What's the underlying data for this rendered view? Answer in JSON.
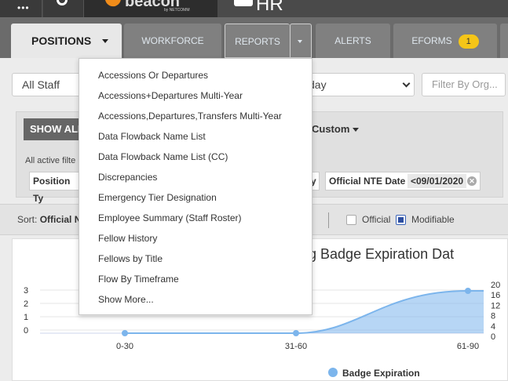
{
  "header": {
    "app_name": "HR",
    "logo_text": "beacon",
    "logo_sub": "by NETCOMM"
  },
  "tabs": [
    {
      "label": "POSITIONS"
    },
    {
      "label": "WORKFORCE"
    },
    {
      "label": "REPORTS"
    },
    {
      "label": "ALERTS"
    },
    {
      "label": "EFORMS",
      "badge": "1"
    }
  ],
  "filters": {
    "staff": "All Staff",
    "day_partial": "day",
    "org_placeholder": "Filter By Org..."
  },
  "panel": {
    "show_all": "SHOW ALL",
    "custom": "Custom",
    "active_filters": "All active filte",
    "chip_position": "Position Ty",
    "chip_y": "y",
    "chip_nte_label": "Official NTE Date",
    "chip_nte_value": "<09/01/2020"
  },
  "sortbar": {
    "sort_prefix": "Sort:",
    "sort_value": "Official N",
    "official": "Official",
    "modifiable": "Modifiable"
  },
  "reports_menu": [
    "Accessions Or Departures",
    "Accessions+Departures Multi-Year",
    "Accessions,Departures,Transfers Multi-Year",
    "Data Flowback Name List",
    "Data Flowback Name List (CC)",
    "Discrepancies",
    "Emergency Tier Designation",
    "Employee Summary (Staff Roster)",
    "Fellow History",
    "Fellows by Title",
    "Flow By Timeframe",
    "Show More..."
  ],
  "chart_title_partial": "ning Badge Expiration Dat",
  "chart_data": {
    "type": "area",
    "title": "ning Badge Expiration Dat",
    "categories": [
      "0-30",
      "31-60",
      "61-90"
    ],
    "series": [
      {
        "name": "Badge Expiration",
        "values": [
          0,
          0,
          18
        ]
      }
    ],
    "left_axis_ticks": [
      "3",
      "2",
      "1",
      "0"
    ],
    "right_axis_ticks": [
      "20",
      "16",
      "12",
      "8",
      "4",
      "0"
    ],
    "ylim": [
      0,
      20
    ],
    "color": "#7cb5ec",
    "legend": "bottom"
  }
}
